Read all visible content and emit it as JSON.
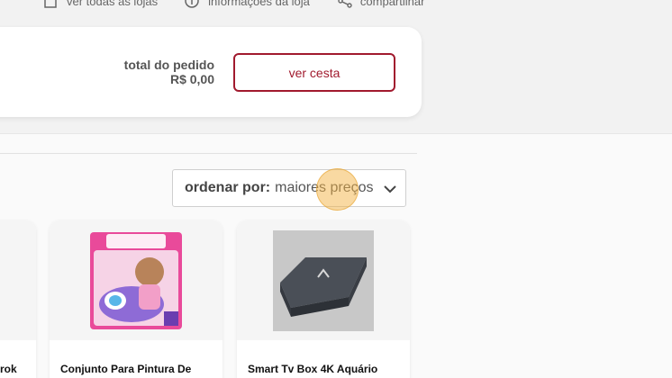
{
  "top_links": [
    {
      "label": "ver todas as lojas",
      "icon": "store-icon"
    },
    {
      "label": "informações da loja",
      "icon": "info-icon"
    },
    {
      "label": "compartilhar",
      "icon": "share-icon"
    }
  ],
  "cart": {
    "total_label": "total do pedido",
    "total_value": "R$ 0,00",
    "button_label": "ver cesta",
    "accent_color": "#a11a2e"
  },
  "sort": {
    "label": "ordenar por:",
    "value": "maiores preços",
    "icon": "chevron-down-icon"
  },
  "products": [
    {
      "title": "rok"
    },
    {
      "title": "Conjunto Para Pintura De",
      "image": "nail-art-kit-box"
    },
    {
      "title": "Smart Tv Box 4K Aquário",
      "image": "tv-box-device"
    }
  ]
}
